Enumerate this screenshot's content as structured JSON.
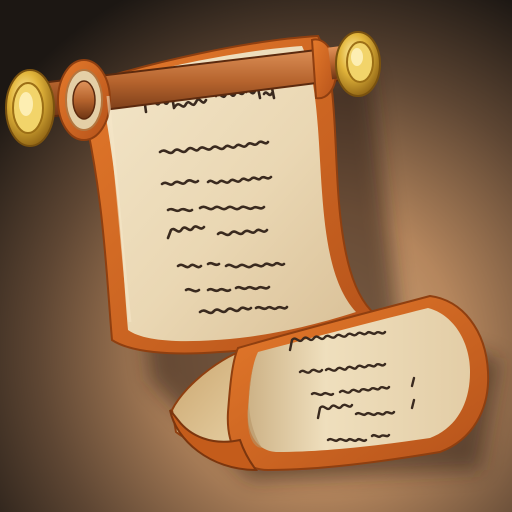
{
  "icon": "scroll-icon",
  "colors": {
    "background_light": "#c99a6e",
    "background_dark": "#1c1713",
    "parchment": "#efe0c2",
    "parchment_shade": "#d6bd93",
    "border": "#d7641f",
    "border_dark": "#a84a12",
    "gold": "#e2b53b",
    "gold_dark": "#9c6f16",
    "rod": "#b5632d",
    "ink": "#3a2a1f"
  },
  "writing": {
    "upper_lines": 8,
    "lower_lines": 5,
    "legible_text": false
  }
}
